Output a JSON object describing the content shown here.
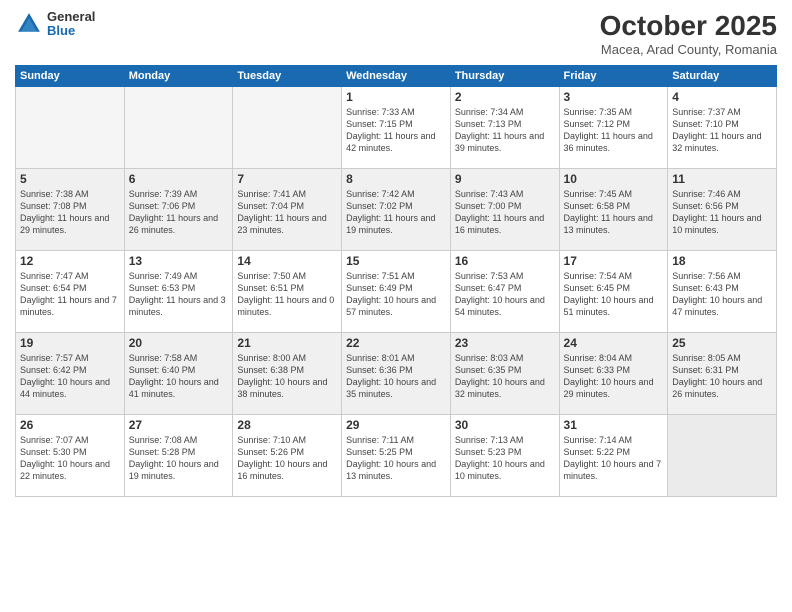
{
  "header": {
    "logo_general": "General",
    "logo_blue": "Blue",
    "month_title": "October 2025",
    "subtitle": "Macea, Arad County, Romania"
  },
  "weekdays": [
    "Sunday",
    "Monday",
    "Tuesday",
    "Wednesday",
    "Thursday",
    "Friday",
    "Saturday"
  ],
  "weeks": [
    [
      {
        "day": "",
        "info": ""
      },
      {
        "day": "",
        "info": ""
      },
      {
        "day": "",
        "info": ""
      },
      {
        "day": "1",
        "info": "Sunrise: 7:33 AM\nSunset: 7:15 PM\nDaylight: 11 hours and 42 minutes."
      },
      {
        "day": "2",
        "info": "Sunrise: 7:34 AM\nSunset: 7:13 PM\nDaylight: 11 hours and 39 minutes."
      },
      {
        "day": "3",
        "info": "Sunrise: 7:35 AM\nSunset: 7:12 PM\nDaylight: 11 hours and 36 minutes."
      },
      {
        "day": "4",
        "info": "Sunrise: 7:37 AM\nSunset: 7:10 PM\nDaylight: 11 hours and 32 minutes."
      }
    ],
    [
      {
        "day": "5",
        "info": "Sunrise: 7:38 AM\nSunset: 7:08 PM\nDaylight: 11 hours and 29 minutes."
      },
      {
        "day": "6",
        "info": "Sunrise: 7:39 AM\nSunset: 7:06 PM\nDaylight: 11 hours and 26 minutes."
      },
      {
        "day": "7",
        "info": "Sunrise: 7:41 AM\nSunset: 7:04 PM\nDaylight: 11 hours and 23 minutes."
      },
      {
        "day": "8",
        "info": "Sunrise: 7:42 AM\nSunset: 7:02 PM\nDaylight: 11 hours and 19 minutes."
      },
      {
        "day": "9",
        "info": "Sunrise: 7:43 AM\nSunset: 7:00 PM\nDaylight: 11 hours and 16 minutes."
      },
      {
        "day": "10",
        "info": "Sunrise: 7:45 AM\nSunset: 6:58 PM\nDaylight: 11 hours and 13 minutes."
      },
      {
        "day": "11",
        "info": "Sunrise: 7:46 AM\nSunset: 6:56 PM\nDaylight: 11 hours and 10 minutes."
      }
    ],
    [
      {
        "day": "12",
        "info": "Sunrise: 7:47 AM\nSunset: 6:54 PM\nDaylight: 11 hours and 7 minutes."
      },
      {
        "day": "13",
        "info": "Sunrise: 7:49 AM\nSunset: 6:53 PM\nDaylight: 11 hours and 3 minutes."
      },
      {
        "day": "14",
        "info": "Sunrise: 7:50 AM\nSunset: 6:51 PM\nDaylight: 11 hours and 0 minutes."
      },
      {
        "day": "15",
        "info": "Sunrise: 7:51 AM\nSunset: 6:49 PM\nDaylight: 10 hours and 57 minutes."
      },
      {
        "day": "16",
        "info": "Sunrise: 7:53 AM\nSunset: 6:47 PM\nDaylight: 10 hours and 54 minutes."
      },
      {
        "day": "17",
        "info": "Sunrise: 7:54 AM\nSunset: 6:45 PM\nDaylight: 10 hours and 51 minutes."
      },
      {
        "day": "18",
        "info": "Sunrise: 7:56 AM\nSunset: 6:43 PM\nDaylight: 10 hours and 47 minutes."
      }
    ],
    [
      {
        "day": "19",
        "info": "Sunrise: 7:57 AM\nSunset: 6:42 PM\nDaylight: 10 hours and 44 minutes."
      },
      {
        "day": "20",
        "info": "Sunrise: 7:58 AM\nSunset: 6:40 PM\nDaylight: 10 hours and 41 minutes."
      },
      {
        "day": "21",
        "info": "Sunrise: 8:00 AM\nSunset: 6:38 PM\nDaylight: 10 hours and 38 minutes."
      },
      {
        "day": "22",
        "info": "Sunrise: 8:01 AM\nSunset: 6:36 PM\nDaylight: 10 hours and 35 minutes."
      },
      {
        "day": "23",
        "info": "Sunrise: 8:03 AM\nSunset: 6:35 PM\nDaylight: 10 hours and 32 minutes."
      },
      {
        "day": "24",
        "info": "Sunrise: 8:04 AM\nSunset: 6:33 PM\nDaylight: 10 hours and 29 minutes."
      },
      {
        "day": "25",
        "info": "Sunrise: 8:05 AM\nSunset: 6:31 PM\nDaylight: 10 hours and 26 minutes."
      }
    ],
    [
      {
        "day": "26",
        "info": "Sunrise: 7:07 AM\nSunset: 5:30 PM\nDaylight: 10 hours and 22 minutes."
      },
      {
        "day": "27",
        "info": "Sunrise: 7:08 AM\nSunset: 5:28 PM\nDaylight: 10 hours and 19 minutes."
      },
      {
        "day": "28",
        "info": "Sunrise: 7:10 AM\nSunset: 5:26 PM\nDaylight: 10 hours and 16 minutes."
      },
      {
        "day": "29",
        "info": "Sunrise: 7:11 AM\nSunset: 5:25 PM\nDaylight: 10 hours and 13 minutes."
      },
      {
        "day": "30",
        "info": "Sunrise: 7:13 AM\nSunset: 5:23 PM\nDaylight: 10 hours and 10 minutes."
      },
      {
        "day": "31",
        "info": "Sunrise: 7:14 AM\nSunset: 5:22 PM\nDaylight: 10 hours and 7 minutes."
      },
      {
        "day": "",
        "info": ""
      }
    ]
  ]
}
